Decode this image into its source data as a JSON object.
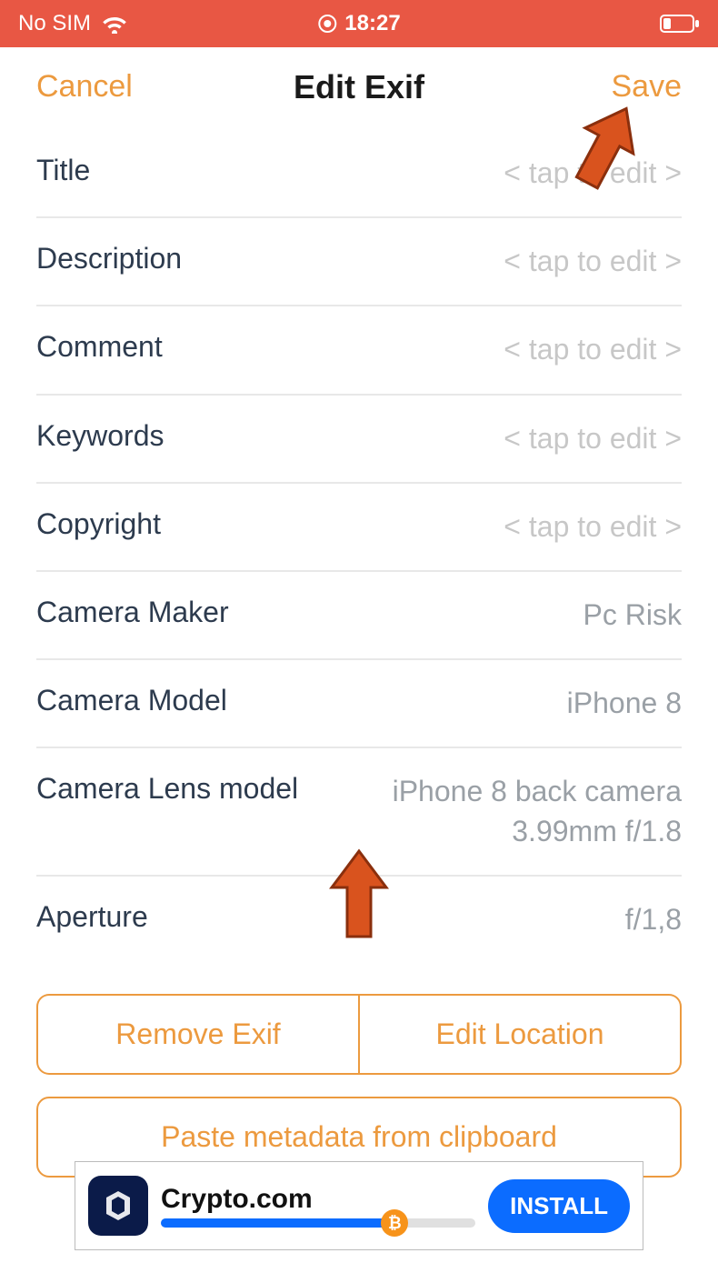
{
  "status": {
    "carrier": "No SIM",
    "time": "18:27"
  },
  "nav": {
    "cancel": "Cancel",
    "title": "Edit Exif",
    "save": "Save"
  },
  "placeholder_text": "< tap to edit >",
  "fields": {
    "title": {
      "label": "Title",
      "value": ""
    },
    "description": {
      "label": "Description",
      "value": ""
    },
    "comment": {
      "label": "Comment",
      "value": ""
    },
    "keywords": {
      "label": "Keywords",
      "value": ""
    },
    "copyright": {
      "label": "Copyright",
      "value": ""
    },
    "camera_maker": {
      "label": "Camera Maker",
      "value": "Pc Risk"
    },
    "camera_model": {
      "label": "Camera Model",
      "value": "iPhone 8"
    },
    "camera_lens": {
      "label": "Camera Lens model",
      "value": "iPhone 8 back camera 3.99mm f/1.8"
    },
    "aperture": {
      "label": "Aperture",
      "value": "f/1,8"
    }
  },
  "buttons": {
    "remove_exif": "Remove Exif",
    "edit_location": "Edit Location",
    "paste_clipboard": "Paste metadata from clipboard"
  },
  "ad": {
    "title": "Crypto.com",
    "install": "INSTALL",
    "progress_percent": 72
  },
  "colors": {
    "status_bg": "#e85744",
    "accent": "#ec9a3f",
    "label": "#2d3b4e",
    "value_gray": "#9aa0a6",
    "ad_blue": "#0b6cff"
  }
}
